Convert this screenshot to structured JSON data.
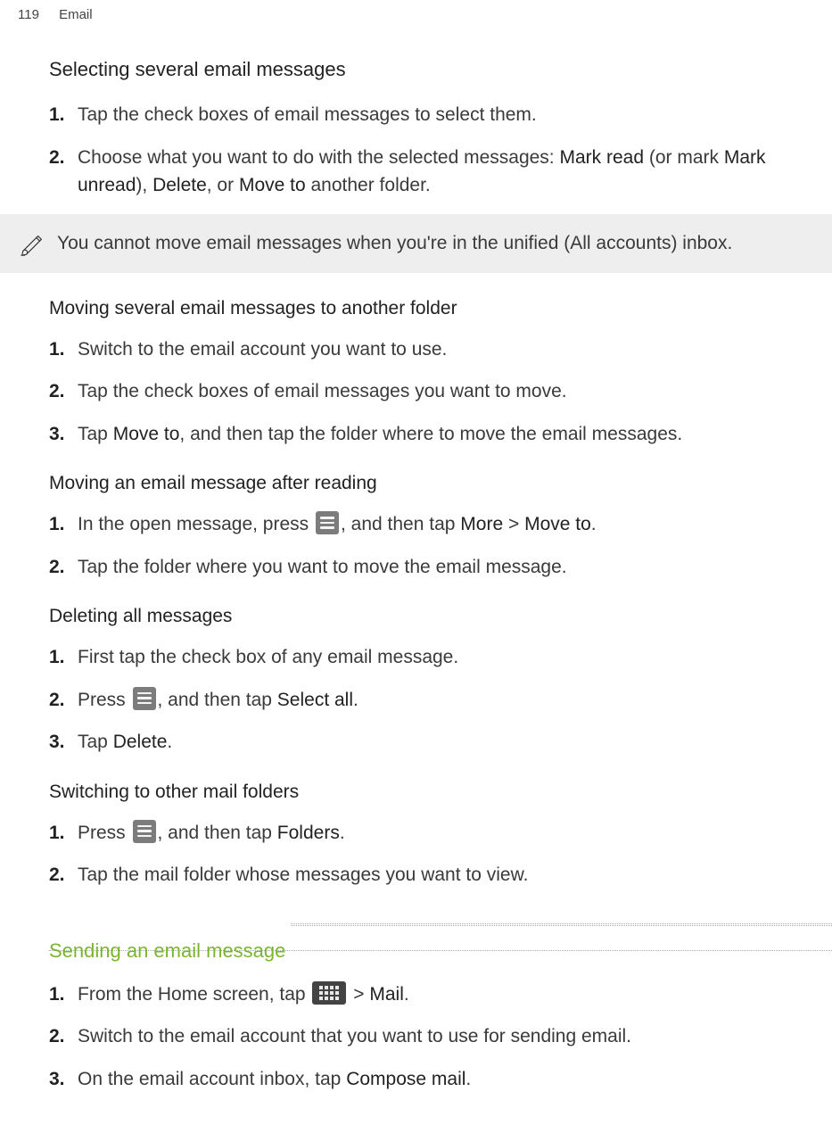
{
  "header": {
    "page_number": "119",
    "section": "Email"
  },
  "s1": {
    "heading": "Selecting several email messages",
    "step1": "Tap the check boxes of email messages to select them.",
    "step2_a": "Choose what you want to do with the selected messages: ",
    "step2_b": "Mark read",
    "step2_c": " (or mark ",
    "step2_d": "Mark unread",
    "step2_e": "), ",
    "step2_f": "Delete",
    "step2_g": ", or ",
    "step2_h": "Move to",
    "step2_i": " another folder."
  },
  "note": {
    "text": "You cannot move email messages when you're in the unified (All accounts) inbox."
  },
  "s2": {
    "heading": "Moving several email messages to another folder",
    "step1": "Switch to the email account you want to use.",
    "step2": "Tap the check boxes of email messages you want to move.",
    "step3_a": "Tap ",
    "step3_b": "Move to",
    "step3_c": ", and then tap the folder where to move the email messages."
  },
  "s3": {
    "heading": "Moving an email message after reading",
    "step1_a": "In the open message, press ",
    "step1_b": ", and then tap ",
    "step1_c": "More",
    "step1_d": " > ",
    "step1_e": "Move to",
    "step1_f": ".",
    "step2": "Tap the folder where you want to move the email message."
  },
  "s4": {
    "heading": "Deleting all messages",
    "step1": "First tap the check box of any email message.",
    "step2_a": "Press ",
    "step2_b": ", and then tap ",
    "step2_c": "Select all",
    "step2_d": ".",
    "step3_a": "Tap ",
    "step3_b": "Delete",
    "step3_c": "."
  },
  "s5": {
    "heading": "Switching to other mail folders",
    "step1_a": "Press ",
    "step1_b": ", and then tap ",
    "step1_c": "Folders",
    "step1_d": ".",
    "step2": "Tap the mail folder whose messages you want to view."
  },
  "s6": {
    "heading": "Sending an email message",
    "step1_a": "From the Home screen, tap ",
    "step1_b": " > ",
    "step1_c": "Mail",
    "step1_d": ".",
    "step2": "Switch to the email account that you want to use for sending email.",
    "step3_a": "On the email account inbox, tap ",
    "step3_b": "Compose mail",
    "step3_c": "."
  },
  "nums": {
    "n1": "1.",
    "n2": "2.",
    "n3": "3."
  }
}
